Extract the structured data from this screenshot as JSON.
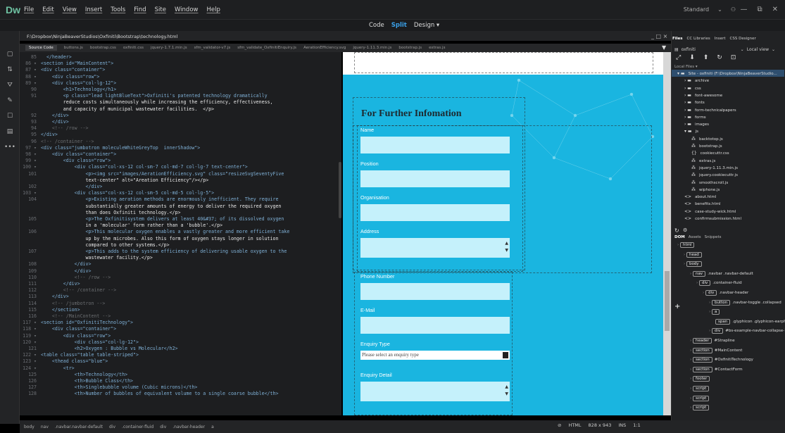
{
  "app": {
    "logo": "Dw",
    "menu": [
      "File",
      "Edit",
      "View",
      "Insert",
      "Tools",
      "Find",
      "Site",
      "Window",
      "Help"
    ],
    "workspace": "Standard",
    "window_controls": [
      "—",
      "⧉",
      "✕"
    ]
  },
  "views": {
    "code": "Code",
    "split": "Split",
    "design": "Design ▾"
  },
  "document": {
    "path": "F:\\Dropbox\\NinjaBeaverStudios\\Oxfiniti\\Bootstrap\\technology.html",
    "header_controls": "_ □ ×",
    "related_files": [
      "Source Code",
      "buttons.js",
      "bootstrap.css",
      "oxfiniti.css",
      "jquery-1.7.1.min.js",
      "sfm_validator-v7.js",
      "sfm_validate_OxfinitiEnquiry.js",
      "AerationEfficiency.svg",
      "jquery-1.11.3.min.js",
      "bootstrap.js",
      "extras.js"
    ]
  },
  "code_lines": [
    {
      "n": "85",
      "t": "  </header>"
    },
    {
      "n": "86 ▾",
      "t": "<section id=\"MainContent\">"
    },
    {
      "n": "87 ▾",
      "t": "<div class=\"container\">"
    },
    {
      "n": "88 ▾",
      "t": "    <div class=\"row\">"
    },
    {
      "n": "89 ▾",
      "t": "    <div class=\"col-lg-12\">"
    },
    {
      "n": "90",
      "t": "        <h1>Technology</h1>"
    },
    {
      "n": "91",
      "t": "        <p class=\"lead lightBlueText\">Oxfiniti's patented technology dramatically"
    },
    {
      "n": "",
      "t": "        reduce costs simultaneously while increasing the efficiency, effectiveness,"
    },
    {
      "n": "",
      "t": "        and capacity of municipal wastewater facilities.  </p>"
    },
    {
      "n": "92",
      "t": "    </div>"
    },
    {
      "n": "93",
      "t": "    </div>"
    },
    {
      "n": "94",
      "t": "    <!-- /row -->"
    },
    {
      "n": "95",
      "t": "</div>"
    },
    {
      "n": "96",
      "t": "<!-- /container -->"
    },
    {
      "n": "97 ▾",
      "t": "<div class=\"jumbotron moleculeWhiteGreyTop  innerShadow\">"
    },
    {
      "n": "98 ▾",
      "t": "    <div class=\"container\">"
    },
    {
      "n": "99 ▾",
      "t": "        <div class=\"row\">"
    },
    {
      "n": "100 ▾",
      "t": "            <div class=\"col-xs-12 col-sm-7 col-md-7 col-lg-7 text-center\">"
    },
    {
      "n": "101",
      "t": "                <p><img src=\"images/AerationEfficiency.svg\" class=\"resizeSvgSeventyFive"
    },
    {
      "n": "",
      "t": "                text-center\" alt=\"Areation Efficiency\"/></p>"
    },
    {
      "n": "102",
      "t": "                </div>"
    },
    {
      "n": "103 ▾",
      "t": "            <div class=\"col-xs-12 col-sm-5 col-md-5 col-lg-5\">"
    },
    {
      "n": "104",
      "t": "                <p>Existing aeration methods are enormously inefficient. They require"
    },
    {
      "n": "",
      "t": "                substantially greater amounts of energy to deliver the required oxygen"
    },
    {
      "n": "",
      "t": "                than does Oxfiniti technology.</p>"
    },
    {
      "n": "105",
      "t": "                <p>The Oxfinitisystem delivers at least 40&#37; of its dissolved oxygen"
    },
    {
      "n": "",
      "t": "                in a 'molecular' form rather than a 'bubble'.</p>"
    },
    {
      "n": "106",
      "t": "                <p>This molecular oxygen enables a vastly greater and more efficient take"
    },
    {
      "n": "",
      "t": "                up by the microbes. Also this form of oxygen stays longer in solution"
    },
    {
      "n": "",
      "t": "                compared to other systems.</p>"
    },
    {
      "n": "107",
      "t": "                <p>This adds to the system efficiency of delivering usable oxygen to the"
    },
    {
      "n": "",
      "t": "                wastewater facility.</p>"
    },
    {
      "n": "108",
      "t": "            </div>"
    },
    {
      "n": "109",
      "t": "            </div>"
    },
    {
      "n": "110",
      "t": "            <!-- /row -->"
    },
    {
      "n": "111",
      "t": "        </div>"
    },
    {
      "n": "112",
      "t": "        <!-- /container -->"
    },
    {
      "n": "113",
      "t": "    </div>"
    },
    {
      "n": "114",
      "t": "    <!-- /jumbotron -->"
    },
    {
      "n": "115",
      "t": "    </section>"
    },
    {
      "n": "116",
      "t": "    <!-- /MainContent -->"
    },
    {
      "n": "117 ▾",
      "t": "<section id=\"OxfinitiTechnology\">"
    },
    {
      "n": "118 ▾",
      "t": "    <div class=\"container\">"
    },
    {
      "n": "119 ▾",
      "t": "        <div class=\"row\">"
    },
    {
      "n": "120 ▾",
      "t": "            <div class=\"col-lg-12\">"
    },
    {
      "n": "121",
      "t": "            <h2>Oxygen : Bubble vs Molecular</h2>"
    },
    {
      "n": "122 ▾",
      "t": "<table class=\"table table-striped\">"
    },
    {
      "n": "123 ▾",
      "t": "    <thead class=\"blue\">"
    },
    {
      "n": "124 ▾",
      "t": "        <tr>"
    },
    {
      "n": "125",
      "t": "            <th>Technology</th>"
    },
    {
      "n": "126",
      "t": "            <th>Bubble Class</th>"
    },
    {
      "n": "127",
      "t": "            <th>Singlebubble volume (Cubic microns)</th>"
    },
    {
      "n": "128",
      "t": "            <th>Number of bubbles of equivalent volume to a single coarse bubble</th>"
    }
  ],
  "design": {
    "heading": "For Further Infomation",
    "fields": [
      {
        "label": "Name"
      },
      {
        "label": "Position"
      },
      {
        "label": "Organisation"
      },
      {
        "label": "Address"
      },
      {
        "label": "Phone Number"
      },
      {
        "label": "E-Mail"
      },
      {
        "label": "Enquiry Type"
      },
      {
        "label": "Enquiry Detail"
      }
    ],
    "select_placeholder": "Please select an enquiry type"
  },
  "status": {
    "tags": [
      "body",
      "nav",
      ".navbar.navbar-default",
      "div",
      ".container-fluid",
      "div",
      ".navbar-header",
      "a"
    ],
    "right": [
      "⊘",
      "HTML",
      "828 x 943",
      "INS",
      "1:1"
    ]
  },
  "panel": {
    "tabs": [
      "Files",
      "CC Libraries",
      "Insert",
      "CSS Designer"
    ],
    "site": "oxfiniti",
    "view": "Local view",
    "local_files": "Local Files ▾",
    "tree": [
      {
        "i": "▾ ▬",
        "t": "Site - oxfiniti (F:\\Dropbox\\NinjaBeaverStudio...",
        "d": 0
      },
      {
        "i": "› ▬",
        "t": "archive",
        "d": 1
      },
      {
        "i": "› ▬",
        "t": "css",
        "d": 1
      },
      {
        "i": "› ▬",
        "t": "font-awesome",
        "d": 1
      },
      {
        "i": "› ▬",
        "t": "fonts",
        "d": 1
      },
      {
        "i": "› ▬",
        "t": "form-technicalpapers",
        "d": 1
      },
      {
        "i": "› ▬",
        "t": "forms",
        "d": 1
      },
      {
        "i": "› ▬",
        "t": "images",
        "d": 1
      },
      {
        "i": "▾ ▬",
        "t": "js",
        "d": 1
      },
      {
        "i": "⁂",
        "t": "backtotop.js",
        "d": 2
      },
      {
        "i": "⁂",
        "t": "bootstrap.js",
        "d": 2
      },
      {
        "i": "{}",
        "t": "cookiecuttr.css",
        "d": 2
      },
      {
        "i": "⁂",
        "t": "extras.js",
        "d": 2
      },
      {
        "i": "⁂",
        "t": "jquery-1.11.3.min.js",
        "d": 2
      },
      {
        "i": "⁂",
        "t": "jquery.cookiecuttr.js",
        "d": 2
      },
      {
        "i": "⁂",
        "t": "smoothscroll.js",
        "d": 2
      },
      {
        "i": "⁂",
        "t": "wiphone.js",
        "d": 2
      },
      {
        "i": "<>",
        "t": "about.html",
        "d": 1
      },
      {
        "i": "<>",
        "t": "benefits.html",
        "d": 1
      },
      {
        "i": "<>",
        "t": "case-study-wick.html",
        "d": 1
      },
      {
        "i": "<>",
        "t": "confirmsubmission.html",
        "d": 1
      }
    ],
    "dom_tabs": [
      "DOM",
      "Assets",
      "Snippets"
    ],
    "dom": [
      {
        "d": 0,
        "p": "html",
        "t": ""
      },
      {
        "d": 1,
        "p": "head",
        "t": ""
      },
      {
        "d": 1,
        "p": "body",
        "t": ""
      },
      {
        "d": 2,
        "p": "nav",
        "t": ".navbar .navbar-default"
      },
      {
        "d": 3,
        "p": "div",
        "t": ".container-fluid"
      },
      {
        "d": 4,
        "p": "div",
        "t": ".navbar-header"
      },
      {
        "d": 5,
        "p": "button",
        "t": ".navbar-toggle .collapsed"
      },
      {
        "d": 5,
        "p": "a",
        "t": ""
      },
      {
        "d": 6,
        "p": "span",
        "t": ".glyphicon .glyphicon-earph"
      },
      {
        "d": 5,
        "p": "div",
        "t": "#bs-example-navbar-collapse-1"
      },
      {
        "d": 2,
        "p": "header",
        "t": "#Strapline"
      },
      {
        "d": 2,
        "p": "section",
        "t": "#MainContent"
      },
      {
        "d": 2,
        "p": "section",
        "t": "#OxfinitiTechnology"
      },
      {
        "d": 2,
        "p": "section",
        "t": "#ContactForm"
      },
      {
        "d": 2,
        "p": "footer",
        "t": ""
      },
      {
        "d": 2,
        "p": "script",
        "t": ""
      },
      {
        "d": 2,
        "p": "script",
        "t": ""
      },
      {
        "d": 2,
        "p": "script",
        "t": ""
      }
    ]
  }
}
